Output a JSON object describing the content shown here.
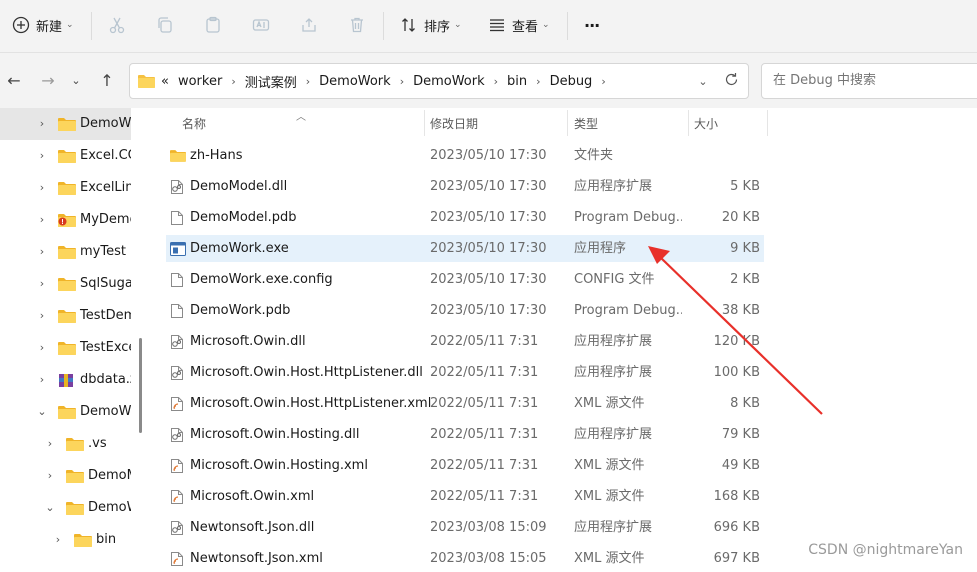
{
  "toolbar": {
    "new_label": "新建",
    "sort_label": "排序",
    "view_label": "查看",
    "more_label": "···"
  },
  "address": {
    "overflow": "«",
    "crumbs": [
      "worker",
      "测试案例",
      "DemoWork",
      "DemoWork",
      "bin",
      "Debug"
    ]
  },
  "search": {
    "placeholder": "在 Debug 中搜索"
  },
  "sidebar": {
    "items": [
      {
        "label": "DemoWork",
        "expanded": false,
        "selected": true
      },
      {
        "label": "Excel.COM",
        "expanded": false
      },
      {
        "label": "ExcelLink",
        "expanded": false
      },
      {
        "label": "MyDemo",
        "expanded": false,
        "icon": "folder-warning-icon"
      },
      {
        "label": "myTest",
        "expanded": false
      },
      {
        "label": "SqlSugar",
        "expanded": false
      },
      {
        "label": "TestDemo",
        "expanded": false
      },
      {
        "label": "TestExcel",
        "expanded": false
      },
      {
        "label": "dbdata.zip",
        "expanded": false,
        "icon": "archive-icon"
      },
      {
        "label": "DemoWork",
        "expanded": true
      },
      {
        "label": ".vs",
        "expanded": false
      },
      {
        "label": "DemoModel",
        "expanded": false
      },
      {
        "label": "DemoWork",
        "expanded": true
      },
      {
        "label": "bin",
        "expanded": false
      }
    ]
  },
  "columns": {
    "name": "名称",
    "date": "修改日期",
    "type": "类型",
    "size": "大小"
  },
  "files": [
    {
      "name": "zh-Hans",
      "date": "2023/05/10 17:30",
      "type": "文件夹",
      "size": "",
      "icon": "folder-icon"
    },
    {
      "name": "DemoModel.dll",
      "date": "2023/05/10 17:30",
      "type": "应用程序扩展",
      "size": "5 KB",
      "icon": "dll-icon"
    },
    {
      "name": "DemoModel.pdb",
      "date": "2023/05/10 17:30",
      "type": "Program Debug...",
      "size": "20 KB",
      "icon": "file-icon"
    },
    {
      "name": "DemoWork.exe",
      "date": "2023/05/10 17:30",
      "type": "应用程序",
      "size": "9 KB",
      "icon": "exe-icon",
      "selected": true
    },
    {
      "name": "DemoWork.exe.config",
      "date": "2023/05/10 17:30",
      "type": "CONFIG 文件",
      "size": "2 KB",
      "icon": "file-icon"
    },
    {
      "name": "DemoWork.pdb",
      "date": "2023/05/10 17:30",
      "type": "Program Debug...",
      "size": "38 KB",
      "icon": "file-icon"
    },
    {
      "name": "Microsoft.Owin.dll",
      "date": "2022/05/11 7:31",
      "type": "应用程序扩展",
      "size": "120 KB",
      "icon": "dll-icon"
    },
    {
      "name": "Microsoft.Owin.Host.HttpListener.dll",
      "date": "2022/05/11 7:31",
      "type": "应用程序扩展",
      "size": "100 KB",
      "icon": "dll-icon"
    },
    {
      "name": "Microsoft.Owin.Host.HttpListener.xml",
      "date": "2022/05/11 7:31",
      "type": "XML 源文件",
      "size": "8 KB",
      "icon": "xml-icon"
    },
    {
      "name": "Microsoft.Owin.Hosting.dll",
      "date": "2022/05/11 7:31",
      "type": "应用程序扩展",
      "size": "79 KB",
      "icon": "dll-icon"
    },
    {
      "name": "Microsoft.Owin.Hosting.xml",
      "date": "2022/05/11 7:31",
      "type": "XML 源文件",
      "size": "49 KB",
      "icon": "xml-icon"
    },
    {
      "name": "Microsoft.Owin.xml",
      "date": "2022/05/11 7:31",
      "type": "XML 源文件",
      "size": "168 KB",
      "icon": "xml-icon"
    },
    {
      "name": "Newtonsoft.Json.dll",
      "date": "2023/03/08 15:09",
      "type": "应用程序扩展",
      "size": "696 KB",
      "icon": "dll-icon"
    },
    {
      "name": "Newtonsoft.Json.xml",
      "date": "2023/03/08 15:05",
      "type": "XML 源文件",
      "size": "697 KB",
      "icon": "xml-icon"
    }
  ],
  "annotation": {
    "color": "#e8302a"
  },
  "watermark": "CSDN @nightmareYan"
}
